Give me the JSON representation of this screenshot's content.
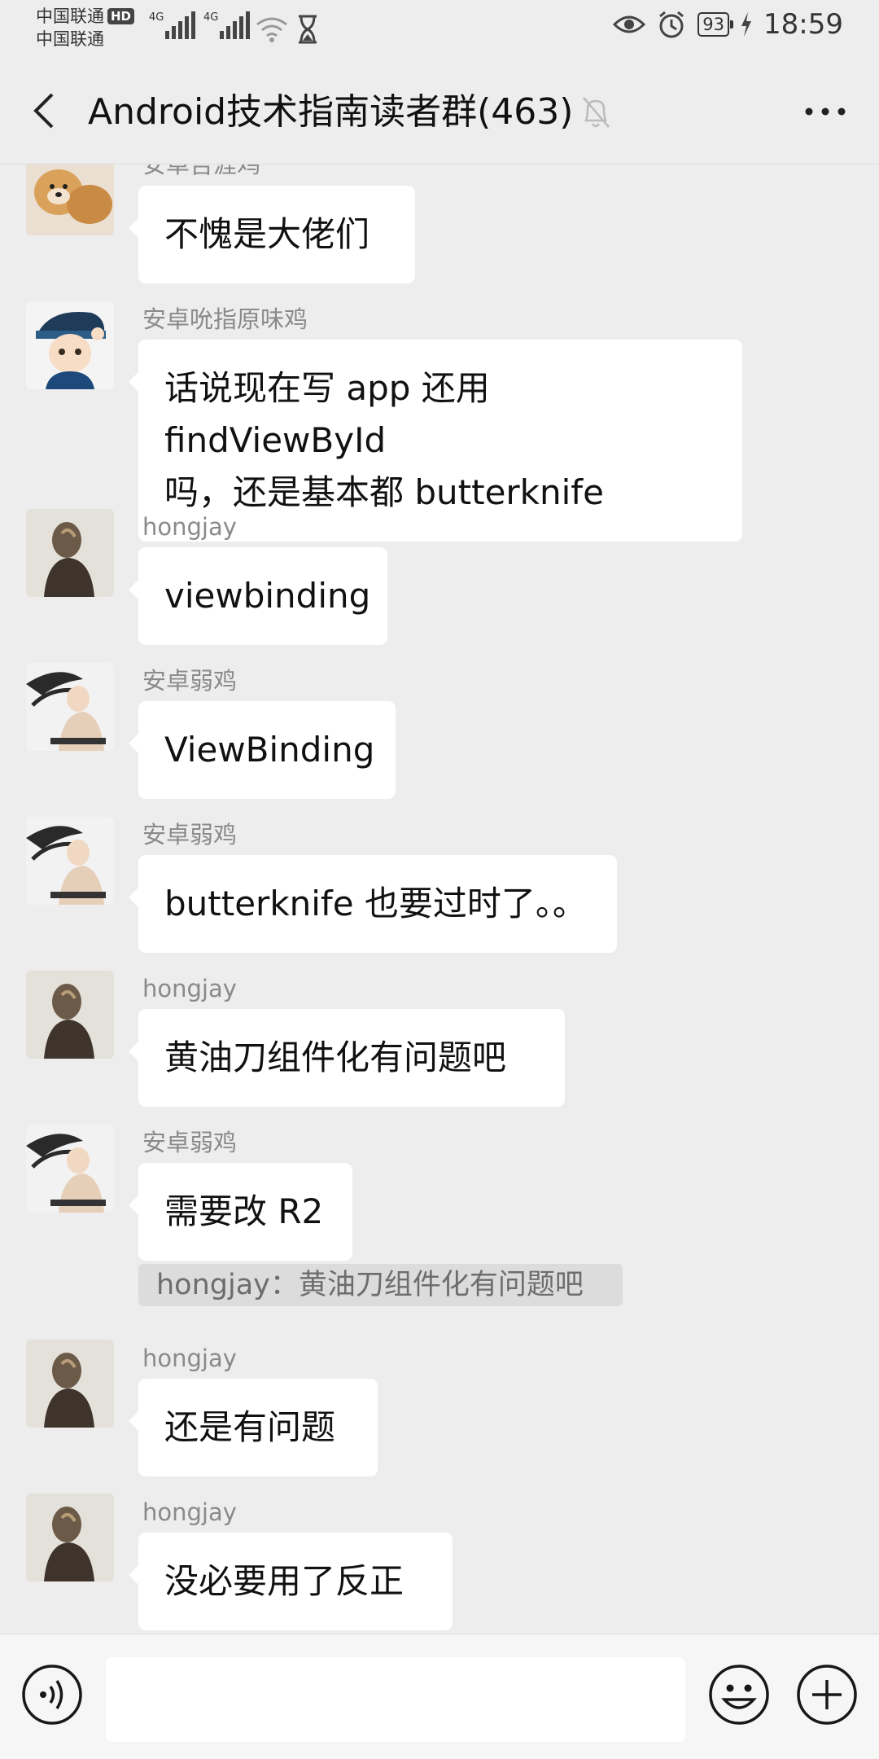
{
  "status_bar": {
    "carrier_1": "中国联通",
    "hd_badge": "HD",
    "carrier_2": "中国联通",
    "network_1": "4G",
    "network_2": "4G",
    "battery": "93",
    "time": "18:59"
  },
  "header": {
    "title": "Android技术指南读者群(463)"
  },
  "messages": [
    {
      "sender": "安卓吉涯鸡",
      "text": "不愧是大佬们",
      "avatar": "dog-avatar"
    },
    {
      "sender": "安卓吮指原味鸡",
      "text_line1": "话说现在写 app 还用 findViewById",
      "text_line2": "吗，还是基本都 butterknife",
      "avatar": "cartoon-boy-avatar"
    },
    {
      "sender": "hongjay",
      "text": "viewbinding",
      "avatar": "silhouette-avatar"
    },
    {
      "sender": "安卓弱鸡",
      "text": "ViewBinding",
      "avatar": "anime-avatar"
    },
    {
      "sender": "安卓弱鸡",
      "text": "butterknife 也要过时了。。",
      "avatar": "anime-avatar"
    },
    {
      "sender": "hongjay",
      "text": "黄油刀组件化有问题吧",
      "avatar": "silhouette-avatar"
    },
    {
      "sender": "安卓弱鸡",
      "text": "需要改 R2",
      "avatar": "anime-avatar",
      "quote": "hongjay：黄油刀组件化有问题吧"
    },
    {
      "sender": "hongjay",
      "text": "还是有问题",
      "avatar": "silhouette-avatar"
    },
    {
      "sender": "hongjay",
      "text": "没必要用了反正",
      "avatar": "silhouette-avatar"
    }
  ],
  "input_bar": {
    "placeholder": "",
    "value": ""
  },
  "colors": {
    "background": "#ededed",
    "bubble": "#ffffff",
    "sender_text": "#8a8a8a",
    "input_bar": "#f6f6f6"
  }
}
